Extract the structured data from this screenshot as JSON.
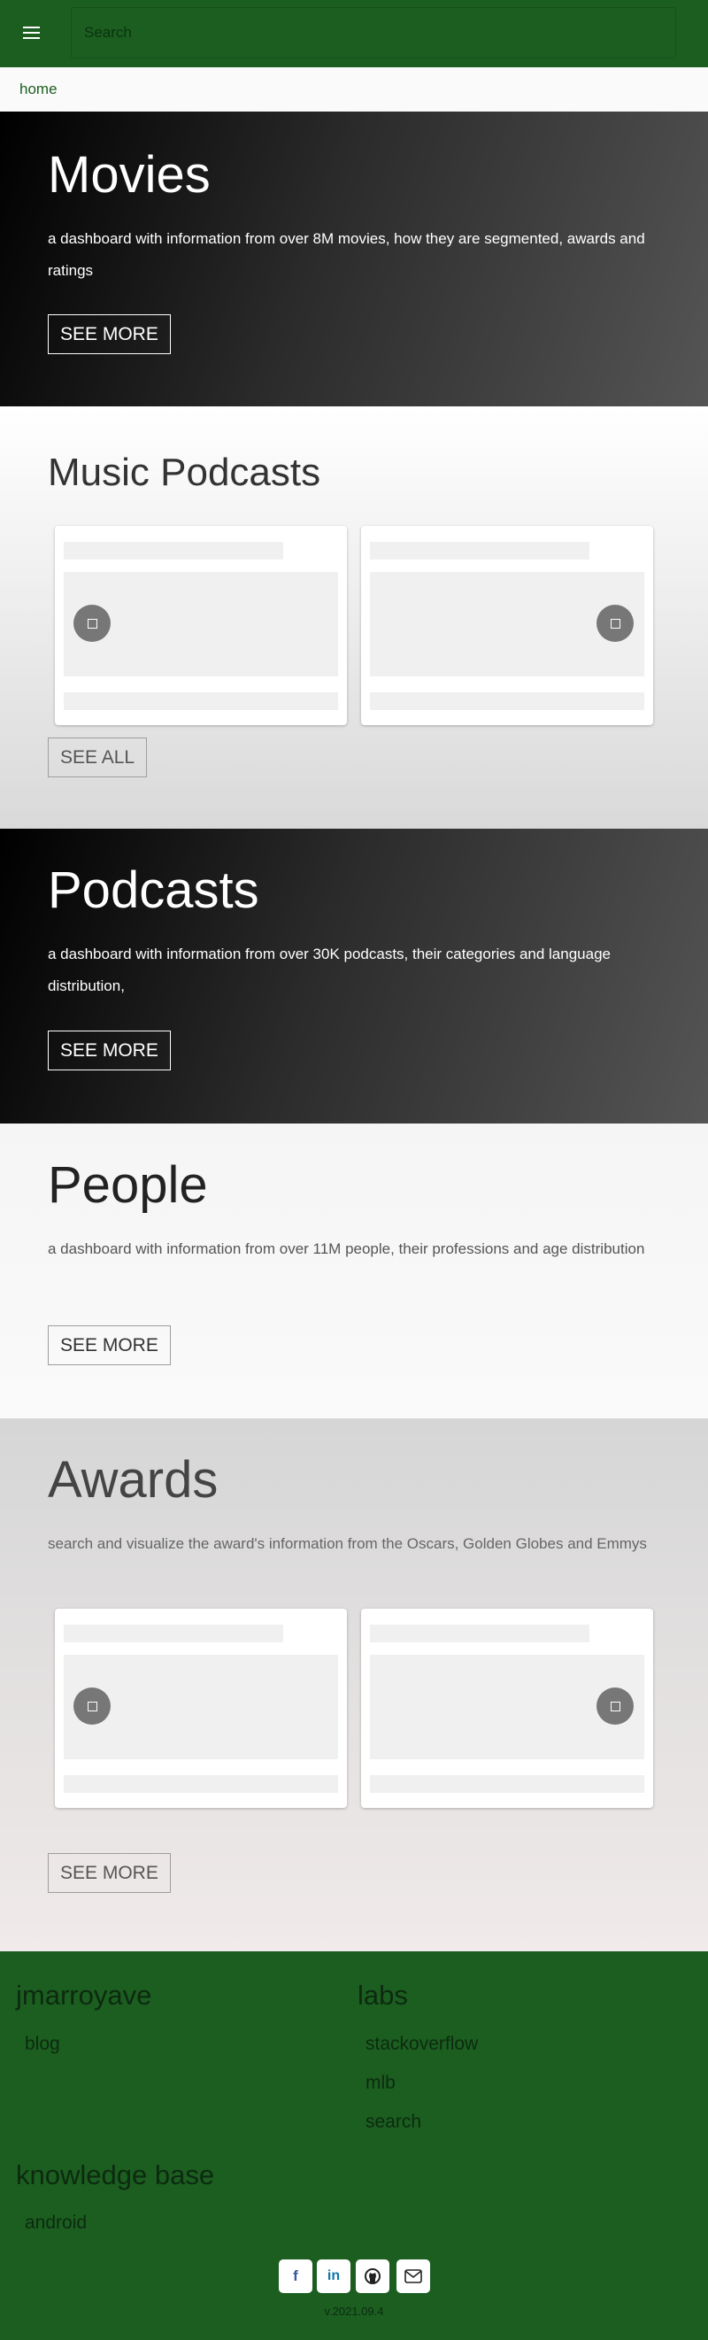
{
  "header": {
    "menu_icon": "hamburger-menu-icon",
    "search_placeholder": "Search"
  },
  "breadcrumb": {
    "home": "home"
  },
  "movies": {
    "title": "Movies",
    "description": "a dashboard with information from over 8M movies, how they are segmented, awards and ratings",
    "button": "SEE MORE"
  },
  "music_podcasts": {
    "title": "Music Podcasts",
    "button": "SEE ALL"
  },
  "podcasts": {
    "title": "Podcasts",
    "description": "a dashboard with information from over 30K podcasts, their categories and language distribution,",
    "button": "SEE MORE"
  },
  "people": {
    "title": "People",
    "description": "a dashboard with information from over 11M people, their professions and age distribution",
    "button": "SEE MORE"
  },
  "awards": {
    "title": "Awards",
    "description": "search and visualize the award's information from the Oscars, Golden Globes and Emmys",
    "button": "SEE MORE"
  },
  "footer": {
    "col1_title": "jmarroyave",
    "col1_links": [
      "blog"
    ],
    "col2_title": "labs",
    "col2_links": [
      "stackoverflow",
      "mlb",
      "search"
    ],
    "col3_title": "knowledge base",
    "col3_links": [
      "android"
    ],
    "social": [
      {
        "label": "f",
        "icon": "facebook-icon",
        "color": "#3b5998"
      },
      {
        "label": "in",
        "icon": "linkedin-icon",
        "color": "#0e76a8"
      },
      {
        "label": "gh",
        "icon": "github-icon",
        "color": "#222222"
      },
      {
        "label": "mail",
        "icon": "email-icon",
        "color": "#222222"
      }
    ],
    "version": "v.2021.09.4"
  },
  "colors": {
    "brand_green": "#1b5e20",
    "dark_gradient_start": "#000000",
    "dark_gradient_end": "#555555"
  }
}
